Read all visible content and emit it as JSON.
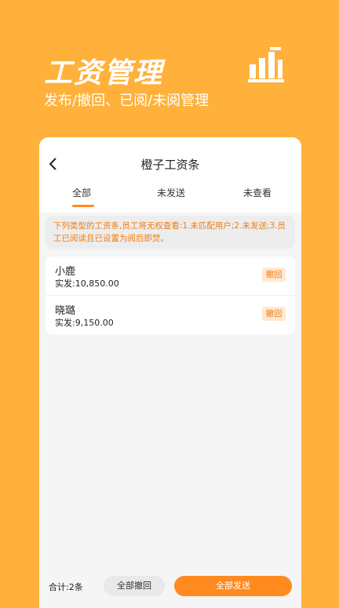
{
  "hero": {
    "title": "工资管理",
    "subtitle": "发布/撤回、已阅/未阅管理",
    "icon": "bar-chart-icon"
  },
  "header": {
    "title": "橙子工资条",
    "back_icon": "back-icon"
  },
  "tabs": [
    {
      "label": "全部",
      "active": true
    },
    {
      "label": "未发送",
      "active": false
    },
    {
      "label": "未查看",
      "active": false
    }
  ],
  "notice": "下列类型的工资条,员工将无权查看:1.未匹配用户;2.未发送;3.员工已阅读且已设置为阅后即焚。",
  "records": [
    {
      "name": "小鹿",
      "amount": "实发:10,850.00",
      "action": "撤回"
    },
    {
      "name": "晓璐",
      "amount": "实发:9,150.00",
      "action": "撤回"
    }
  ],
  "footer": {
    "total": "合计:2条",
    "revoke_all": "全部撤回",
    "send_all": "全部发送"
  },
  "colors": {
    "background": "#FFB13B",
    "accent": "#FF8A1F",
    "notice_text": "#F07D12"
  }
}
